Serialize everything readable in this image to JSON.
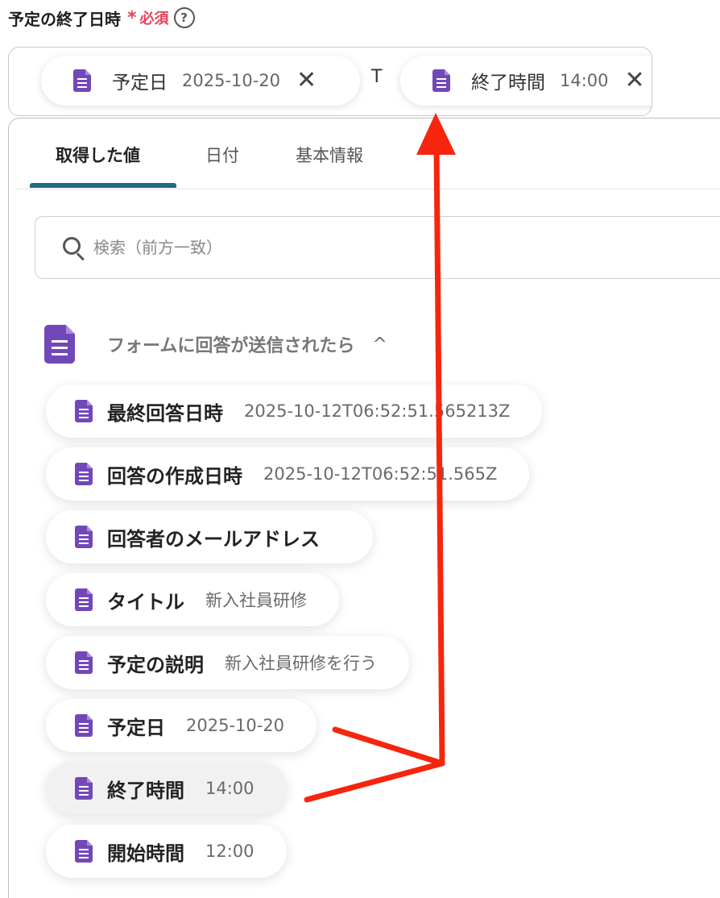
{
  "field": {
    "label": "予定の終了日時",
    "asterisk": "*",
    "required": "必須",
    "help": "?"
  },
  "input": {
    "separator": "T",
    "chips": [
      {
        "label": "予定日",
        "value": "2025-10-20",
        "close": "✕"
      },
      {
        "label": "終了時間",
        "value": "14:00",
        "close": "✕"
      }
    ]
  },
  "tabs": [
    {
      "label": "取得した値",
      "active": true
    },
    {
      "label": "日付",
      "active": false
    },
    {
      "label": "基本情報",
      "active": false
    }
  ],
  "search": {
    "placeholder": "検索（前方一致）"
  },
  "group": {
    "title": "フォームに回答が送信されたら",
    "chevron": "^"
  },
  "items": [
    {
      "label": "最終回答日時",
      "value": "2025-10-12T06:52:51.565213Z"
    },
    {
      "label": "回答の作成日時",
      "value": "2025-10-12T06:52:51.565Z"
    },
    {
      "label": "回答者のメールアドレス",
      "value": ""
    },
    {
      "label": "タイトル",
      "value": "新入社員研修"
    },
    {
      "label": "予定の説明",
      "value": "新入社員研修を行う"
    },
    {
      "label": "予定日",
      "value": "2025-10-20"
    },
    {
      "label": "終了時間",
      "value": "14:00"
    },
    {
      "label": "開始時間",
      "value": "12:00"
    }
  ],
  "colors": {
    "form_icon": "#7248b9",
    "required": "#e8435a",
    "tab_underline": "#1e6a85",
    "annotation_arrow": "#f5260d"
  }
}
